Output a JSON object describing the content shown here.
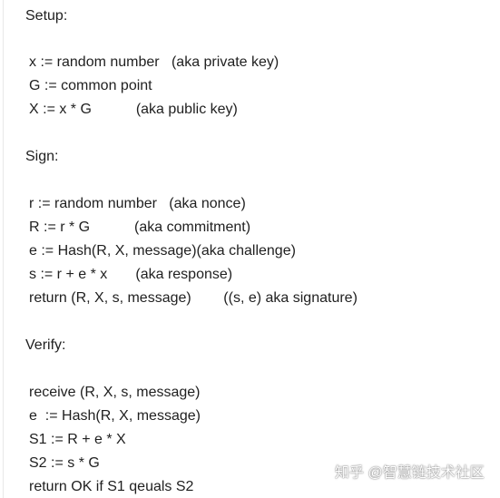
{
  "sections": [
    {
      "heading": "Setup:",
      "lines": [
        "x := random number   (aka private key)",
        "G := common point",
        "X := x * G           (aka public key)"
      ]
    },
    {
      "heading": "Sign:",
      "lines": [
        "r := random number   (aka nonce)",
        "R := r * G           (aka commitment)",
        "e := Hash(R, X, message)(aka challenge)",
        "s := r + e * x       (aka response)",
        "return (R, X, s, message)        ((s, e) aka signature)"
      ]
    },
    {
      "heading": "Verify:",
      "lines": [
        "receive (R, X, s, message)",
        "e  := Hash(R, X, message)",
        "S1 := R + e * X",
        "S2 := s * G",
        "return OK if S1 qeuals S2"
      ]
    }
  ],
  "watermark": "知乎 @智慧链技术社区"
}
